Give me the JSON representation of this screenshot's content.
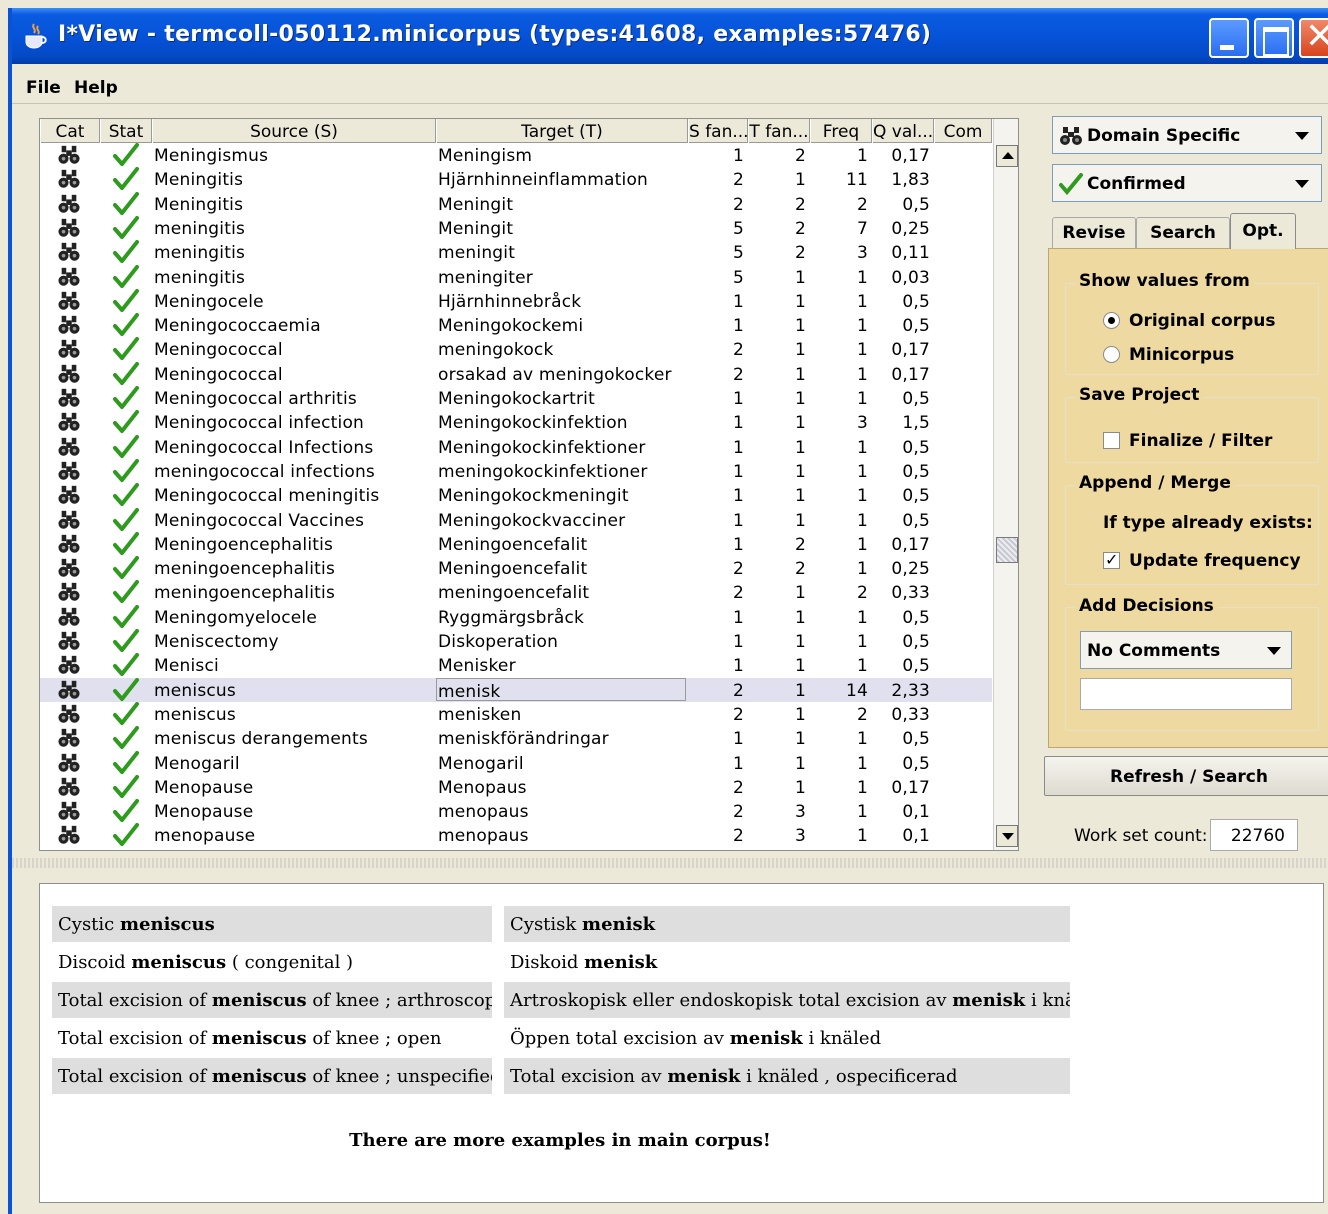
{
  "window": {
    "title": "I*View - termcoll-050112.minicorpus (types:41608, examples:57476)"
  },
  "menu": [
    "File",
    "Help"
  ],
  "table": {
    "columns": [
      "Cat",
      "Stat",
      "Source (S)",
      "Target (T)",
      "S fan...",
      "T fan...",
      "Freq",
      "Q val...",
      "Com"
    ],
    "rows": [
      {
        "source": "Meningismus",
        "target": "Meningism",
        "sfan": "1",
        "tfan": "2",
        "freq": "1",
        "qval": "0,17"
      },
      {
        "source": "Meningitis",
        "target": "Hjärnhinneinflammation",
        "sfan": "2",
        "tfan": "1",
        "freq": "11",
        "qval": "1,83"
      },
      {
        "source": "Meningitis",
        "target": "Meningit",
        "sfan": "2",
        "tfan": "2",
        "freq": "2",
        "qval": "0,5"
      },
      {
        "source": "meningitis",
        "target": "Meningit",
        "sfan": "5",
        "tfan": "2",
        "freq": "7",
        "qval": "0,25"
      },
      {
        "source": "meningitis",
        "target": "meningit",
        "sfan": "5",
        "tfan": "2",
        "freq": "3",
        "qval": "0,11"
      },
      {
        "source": "meningitis",
        "target": "meningiter",
        "sfan": "5",
        "tfan": "1",
        "freq": "1",
        "qval": "0,03"
      },
      {
        "source": "Meningocele",
        "target": "Hjärnhinnebråck",
        "sfan": "1",
        "tfan": "1",
        "freq": "1",
        "qval": "0,5"
      },
      {
        "source": "Meningococcaemia",
        "target": "Meningokockemi",
        "sfan": "1",
        "tfan": "1",
        "freq": "1",
        "qval": "0,5"
      },
      {
        "source": "Meningococcal",
        "target": "meningokock",
        "sfan": "2",
        "tfan": "1",
        "freq": "1",
        "qval": "0,17"
      },
      {
        "source": "Meningococcal",
        "target": "orsakad av meningokocker",
        "sfan": "2",
        "tfan": "1",
        "freq": "1",
        "qval": "0,17"
      },
      {
        "source": "Meningococcal arthritis",
        "target": "Meningokockartrit",
        "sfan": "1",
        "tfan": "1",
        "freq": "1",
        "qval": "0,5"
      },
      {
        "source": "Meningococcal infection",
        "target": "Meningokockinfektion",
        "sfan": "1",
        "tfan": "1",
        "freq": "3",
        "qval": "1,5"
      },
      {
        "source": "Meningococcal Infections",
        "target": "Meningokockinfektioner",
        "sfan": "1",
        "tfan": "1",
        "freq": "1",
        "qval": "0,5"
      },
      {
        "source": "meningococcal infections",
        "target": "meningokockinfektioner",
        "sfan": "1",
        "tfan": "1",
        "freq": "1",
        "qval": "0,5"
      },
      {
        "source": "Meningococcal meningitis",
        "target": "Meningokockmeningit",
        "sfan": "1",
        "tfan": "1",
        "freq": "1",
        "qval": "0,5"
      },
      {
        "source": "Meningococcal Vaccines",
        "target": "Meningokockvacciner",
        "sfan": "1",
        "tfan": "1",
        "freq": "1",
        "qval": "0,5"
      },
      {
        "source": "Meningoencephalitis",
        "target": "Meningoencefalit",
        "sfan": "1",
        "tfan": "2",
        "freq": "1",
        "qval": "0,17"
      },
      {
        "source": "meningoencephalitis",
        "target": "Meningoencefalit",
        "sfan": "2",
        "tfan": "2",
        "freq": "1",
        "qval": "0,25"
      },
      {
        "source": "meningoencephalitis",
        "target": "meningoencefalit",
        "sfan": "2",
        "tfan": "1",
        "freq": "2",
        "qval": "0,33"
      },
      {
        "source": "Meningomyelocele",
        "target": "Ryggmärgsbråck",
        "sfan": "1",
        "tfan": "1",
        "freq": "1",
        "qval": "0,5"
      },
      {
        "source": "Meniscectomy",
        "target": "Diskoperation",
        "sfan": "1",
        "tfan": "1",
        "freq": "1",
        "qval": "0,5"
      },
      {
        "source": "Menisci",
        "target": "Menisker",
        "sfan": "1",
        "tfan": "1",
        "freq": "1",
        "qval": "0,5"
      },
      {
        "source": "meniscus",
        "target": "menisk",
        "sfan": "2",
        "tfan": "1",
        "freq": "14",
        "qval": "2,33",
        "selected": true
      },
      {
        "source": "meniscus",
        "target": "menisken",
        "sfan": "2",
        "tfan": "1",
        "freq": "2",
        "qval": "0,33"
      },
      {
        "source": "meniscus derangements",
        "target": "meniskförändringar",
        "sfan": "1",
        "tfan": "1",
        "freq": "1",
        "qval": "0,5"
      },
      {
        "source": "Menogaril",
        "target": "Menogaril",
        "sfan": "1",
        "tfan": "1",
        "freq": "1",
        "qval": "0,5"
      },
      {
        "source": "Menopause",
        "target": "Menopaus",
        "sfan": "2",
        "tfan": "1",
        "freq": "1",
        "qval": "0,17"
      },
      {
        "source": "Menopause",
        "target": "menopaus",
        "sfan": "2",
        "tfan": "3",
        "freq": "1",
        "qval": "0,1"
      },
      {
        "source": "menopause",
        "target": "menopaus",
        "sfan": "2",
        "tfan": "3",
        "freq": "1",
        "qval": "0,1"
      }
    ]
  },
  "right": {
    "domain_combo": "Domain Specific",
    "status_combo": "Confirmed",
    "tabs": [
      "Revise",
      "Search",
      "Opt."
    ],
    "active_tab": "Opt.",
    "show_values_from": {
      "title": "Show values from",
      "options": [
        "Original corpus",
        "Minicorpus"
      ],
      "selected": "Original corpus"
    },
    "save_project": {
      "title": "Save Project",
      "finalize_label": "Finalize / Filter",
      "finalize_checked": false
    },
    "append_merge": {
      "title": "Append / Merge",
      "subtitle": "If type already exists:",
      "update_label": "Update frequency",
      "update_checked": true
    },
    "add_decisions": {
      "title": "Add Decisions",
      "combo": "No Comments",
      "input_value": ""
    },
    "refresh_button": "Refresh / Search",
    "workset_label": "Work set count:",
    "workset_value": "22760"
  },
  "examples": {
    "rows": [
      {
        "src_pre": "Cystic ",
        "src_bold": "meniscus",
        "src_post": "",
        "tgt_pre": "Cystisk ",
        "tgt_bold": "menisk",
        "tgt_post": "",
        "shaded": true
      },
      {
        "src_pre": "Discoid ",
        "src_bold": "meniscus",
        "src_post": " ( congenital )",
        "tgt_pre": "Diskoid ",
        "tgt_bold": "menisk",
        "tgt_post": "",
        "shaded": false
      },
      {
        "src_pre": "Total excision of ",
        "src_bold": "meniscus",
        "src_post": " of knee ; arthroscopic",
        "tgt_pre": "Artroskopisk eller endoskopisk total excision av ",
        "tgt_bold": "menisk",
        "tgt_post": " i knäled",
        "shaded": true
      },
      {
        "src_pre": "Total excision of ",
        "src_bold": "meniscus",
        "src_post": " of knee ; open",
        "tgt_pre": "Öppen total excision av ",
        "tgt_bold": "menisk",
        "tgt_post": " i knäled",
        "shaded": false
      },
      {
        "src_pre": "Total excision of ",
        "src_bold": "meniscus",
        "src_post": " of knee ; unspecified",
        "tgt_pre": "Total excision av ",
        "tgt_bold": "menisk",
        "tgt_post": " i knäled , ospecificerad",
        "shaded": true
      }
    ],
    "footer": "There are more examples in main corpus!"
  },
  "icons": {
    "cat": "binoculars-icon",
    "stat": "checkmark-icon",
    "check_color": "#2e9a1e"
  }
}
